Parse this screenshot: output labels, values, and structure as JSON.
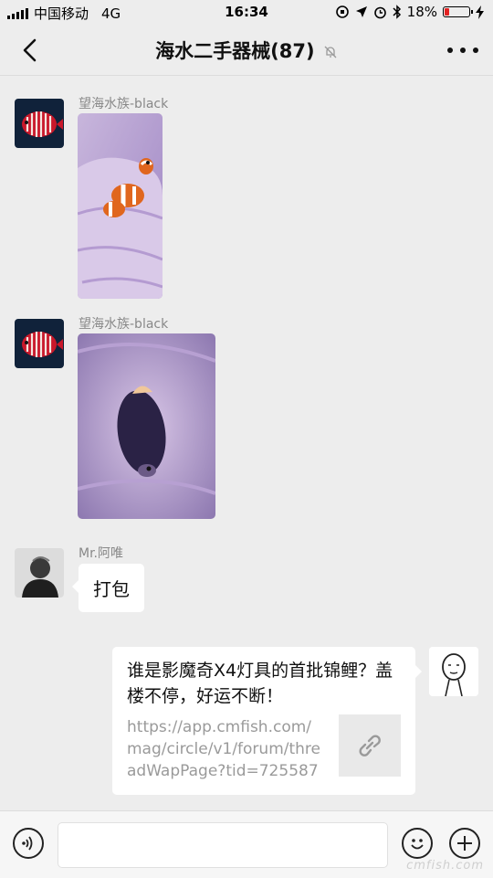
{
  "status": {
    "carrier": "中国移动",
    "network": "4G",
    "time": "16:34",
    "battery": "18%",
    "battery_level": 0.18
  },
  "header": {
    "title": "海水二手器械(87)",
    "back_icon": "chevron-left-icon",
    "mute_icon": "bell-muted-icon",
    "more_icon": "more-dots-icon"
  },
  "messages": [
    {
      "sender": "望海水族-black",
      "type": "image",
      "subject": "clownfish in hand"
    },
    {
      "sender": "望海水族-black",
      "type": "image",
      "subject": "dark fish in palm"
    },
    {
      "sender": "Mr.阿唯",
      "type": "text",
      "text": "打包"
    },
    {
      "sender": "self",
      "type": "link",
      "title": "谁是影魔奇X4灯具的首批锦鲤？盖楼不停，好运不断！",
      "url": "https://app.cmfish.com/mag/circle/v1/forum/threadWapPage?tid=725587&..."
    }
  ],
  "input": {
    "voice_icon": "voice-icon",
    "emoji_icon": "emoji-icon",
    "add_icon": "plus-icon"
  },
  "watermark": "cmfish.com",
  "colors": {
    "background": "#ededed",
    "bubble": "#ffffff",
    "battery_low": "#e22222"
  }
}
